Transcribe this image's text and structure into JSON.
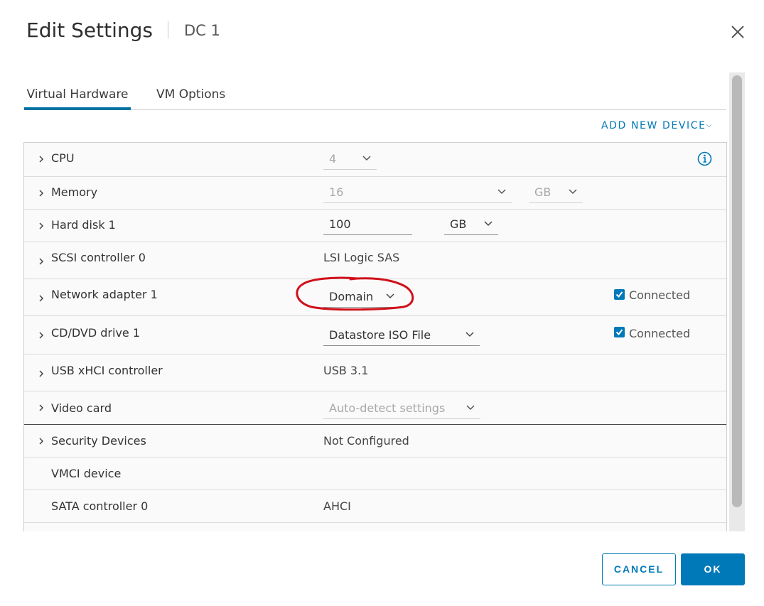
{
  "dialog": {
    "title": "Edit Settings",
    "vm_name": "DC 1"
  },
  "tabs": [
    {
      "label": "Virtual Hardware",
      "active": true
    },
    {
      "label": "VM Options",
      "active": false
    }
  ],
  "add_new_device": "ADD NEW DEVICE",
  "hardware": {
    "cpu": {
      "label": "CPU",
      "value": "4"
    },
    "memory": {
      "label": "Memory",
      "value": "16",
      "unit": "GB"
    },
    "hard_disk": {
      "label": "Hard disk 1",
      "value": "100",
      "unit": "GB"
    },
    "scsi": {
      "label": "SCSI controller 0",
      "value": "LSI Logic SAS"
    },
    "network": {
      "label": "Network adapter 1",
      "value": "Domain",
      "connected_label": "Connected",
      "connected": true
    },
    "cdrom": {
      "label": "CD/DVD drive 1",
      "value": "Datastore ISO File",
      "connected_label": "Connected",
      "connected": true
    },
    "usb": {
      "label": "USB xHCI controller",
      "value": "USB 3.1"
    },
    "video": {
      "label": "Video card",
      "value": "Auto-detect settings"
    },
    "security": {
      "label": "Security Devices",
      "value": "Not Configured"
    },
    "vmci": {
      "label": "VMCI device"
    },
    "sata": {
      "label": "SATA controller 0",
      "value": "AHCI"
    }
  },
  "buttons": {
    "cancel": "CANCEL",
    "ok": "OK"
  },
  "colors": {
    "accent": "#0079b8",
    "annotation": "#d0101a"
  },
  "icons": [
    "close-icon",
    "info-icon",
    "chevron-right-icon",
    "chevron-down-icon",
    "checkbox-checked-icon"
  ]
}
